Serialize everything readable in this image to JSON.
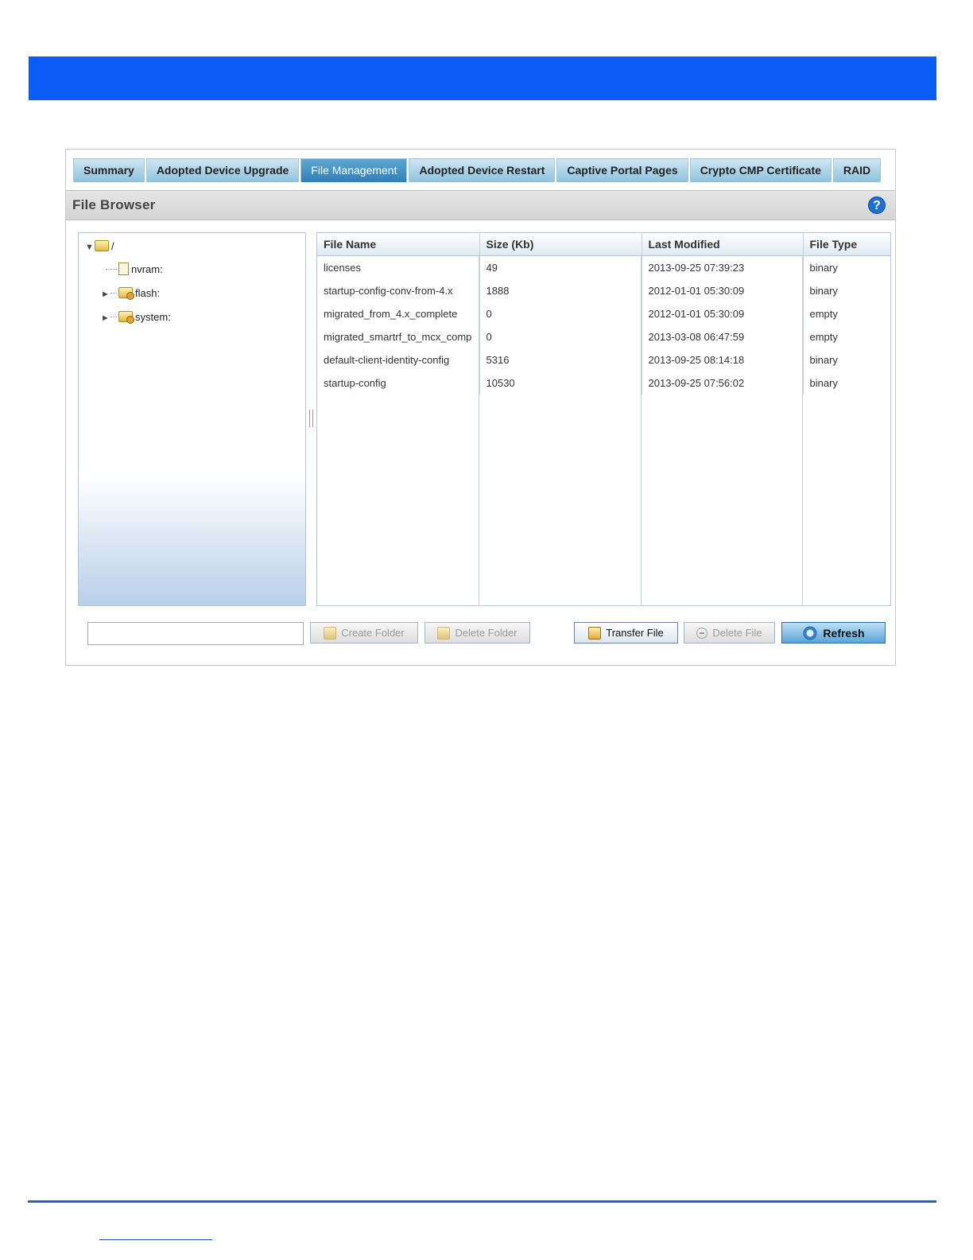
{
  "tabs": [
    {
      "label": "Summary",
      "active": false
    },
    {
      "label": "Adopted Device Upgrade",
      "active": false
    },
    {
      "label": "File Management",
      "active": true
    },
    {
      "label": "Adopted Device Restart",
      "active": false
    },
    {
      "label": "Captive Portal Pages",
      "active": false
    },
    {
      "label": "Crypto CMP Certificate",
      "active": false
    },
    {
      "label": "RAID",
      "active": false
    }
  ],
  "file_browser": {
    "title": "File Browser",
    "help_icon": "question-mark-icon"
  },
  "tree": {
    "root": "/",
    "children": [
      "nvram:",
      "flash:",
      "system:"
    ]
  },
  "grid": {
    "columns": [
      "File Name",
      "Size (Kb)",
      "Last Modified",
      "File Type"
    ],
    "rows": [
      [
        "licenses",
        "49",
        "2013-09-25 07:39:23",
        "binary"
      ],
      [
        "startup-config-conv-from-4.x",
        "1888",
        "2012-01-01 05:30:09",
        "binary"
      ],
      [
        "migrated_from_4.x_complete",
        "0",
        "2012-01-01 05:30:09",
        "empty"
      ],
      [
        "migrated_smartrf_to_mcx_comp",
        "0",
        "2013-03-08 06:47:59",
        "empty"
      ],
      [
        "default-client-identity-config",
        "5316",
        "2013-09-25 08:14:18",
        "binary"
      ],
      [
        "startup-config",
        "10530",
        "2013-09-25 07:56:02",
        "binary"
      ]
    ]
  },
  "path_input": {
    "value": ""
  },
  "buttons": {
    "create_folder": "Create Folder",
    "delete_folder": "Delete Folder",
    "transfer_file": "Transfer File",
    "delete_file": "Delete File",
    "refresh": "Refresh"
  },
  "colors": {
    "header_band": "#0a5cf5",
    "footer_rule": "#1a62d8",
    "active_tab": "#3a87bd"
  }
}
